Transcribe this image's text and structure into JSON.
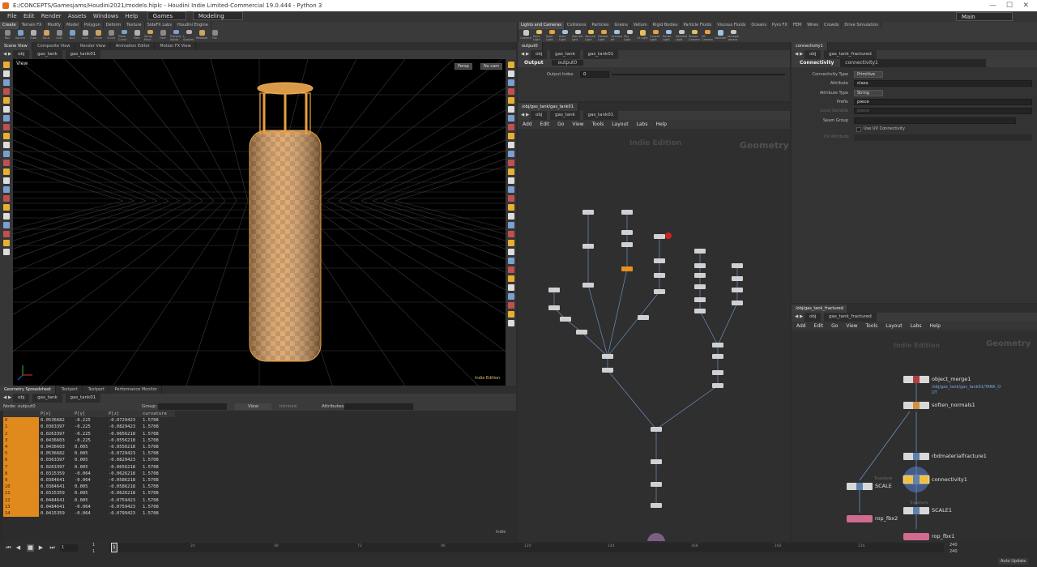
{
  "titlebar": {
    "path": "E:/CONCEPTS/Gamesjams/Houdini2021/models.hiplc - Houdini Indie Limited-Commercial 19.0.444 - Python 3",
    "workspace": "Main"
  },
  "menubar": {
    "items": [
      "File",
      "Edit",
      "Render",
      "Assets",
      "Windows",
      "Help"
    ],
    "desktops": [
      "Games",
      "Modeling"
    ]
  },
  "shelf_tabs_left": [
    "Create",
    "Terrain FX",
    "Modify",
    "Model",
    "Polygon",
    "Deform",
    "Texture",
    "SideFX Labs",
    "Houdini Engine"
  ],
  "shelf_tools_left": [
    "Box",
    "Sphere",
    "Tube",
    "Torus",
    "Grid",
    "Null",
    "Line",
    "Circle",
    "Curve",
    "Draw Curve",
    "Path",
    "Spray Paint",
    "Font",
    "Platonic Solids",
    "L-System",
    "Metaball",
    "File"
  ],
  "shelf_tabs_right": [
    "Lights and Cameras",
    "Collisions",
    "Particles",
    "Grains",
    "Vellum",
    "Rigid Bodies",
    "Particle Fluids",
    "Viscous Fluids",
    "Oceans",
    "Pyro FX",
    "FEM",
    "Wires",
    "Crowds",
    "Drive Simulation"
  ],
  "shelf_tools_right": [
    "Camera",
    "Point Light",
    "Spot Light",
    "Area Light",
    "Geometry Light",
    "Volume Light",
    "Distant Light",
    "Environment Light",
    "Sky Light",
    "GI Light",
    "Caustic Light",
    "Portal Light",
    "Ambient Light",
    "Stereo Camera",
    "VR Camera",
    "Switcher",
    "Gamepad Camera"
  ],
  "viewport": {
    "tabs": [
      "Scene View",
      "Composite View",
      "Render View",
      "Animation Editor",
      "Motion FX View"
    ],
    "path": [
      "obj",
      "gas_tank",
      "gas_tank01"
    ],
    "label": "View",
    "persp": "Persp",
    "cam": "No cam",
    "edition": "Indie Edition"
  },
  "spreadsheet": {
    "tabs": [
      "Geometry Spreadsheet",
      "Textport",
      "Textport",
      "Performance Monitor"
    ],
    "path": [
      "obj",
      "gas_tank",
      "gas_tank01"
    ],
    "node": "Node: output0",
    "group_label": "Group:",
    "view_label": "View",
    "intrinsic_label": "Intrinsic",
    "attributes_label": "Attributes:",
    "columns": [
      "",
      "P[x]",
      "P[y]",
      "P[z]",
      "curvature"
    ],
    "rows": [
      [
        "0",
        "0.0536682",
        "-0.225",
        "-0.0729423",
        "1.5708"
      ],
      [
        "1",
        "0.0363397",
        "-0.225",
        "-0.0829423",
        "1.5708"
      ],
      [
        "2",
        "0.0263397",
        "-0.225",
        "-0.0656218",
        "1.5708"
      ],
      [
        "3",
        "0.0436603",
        "-0.225",
        "-0.0556218",
        "1.5708"
      ],
      [
        "4",
        "0.0436603",
        "0.005",
        "-0.0556218",
        "1.5708"
      ],
      [
        "5",
        "0.0536682",
        "0.005",
        "-0.0729423",
        "1.5708"
      ],
      [
        "6",
        "0.0363397",
        "0.005",
        "-0.0829423",
        "1.5708"
      ],
      [
        "7",
        "0.0263397",
        "0.005",
        "-0.0656218",
        "1.5708"
      ],
      [
        "8",
        "0.0315359",
        "-0.064",
        "-0.0626218",
        "1.5708"
      ],
      [
        "9",
        "0.0384641",
        "-0.064",
        "-0.0586218",
        "1.5708"
      ],
      [
        "10",
        "0.0384641",
        "0.005",
        "-0.0586218",
        "1.5708"
      ],
      [
        "11",
        "0.0315359",
        "0.005",
        "-0.0626218",
        "1.5708"
      ],
      [
        "12",
        "0.0484641",
        "0.005",
        "-0.0759423",
        "1.5708"
      ],
      [
        "13",
        "0.0484641",
        "-0.064",
        "-0.0759423",
        "1.5708"
      ],
      [
        "14",
        "0.0415359",
        "-0.064",
        "-0.0799423",
        "1.5708"
      ]
    ],
    "footer": "Indie"
  },
  "output_pane": {
    "tab": "output0",
    "path": [
      "obj",
      "gas_tank",
      "gas_tank01"
    ],
    "node_type": "Output",
    "node_name": "output0",
    "param_label": "Output Index",
    "param_value": "0"
  },
  "network_center": {
    "tab": "/obj/gas_tank/gas_tank01",
    "path": [
      "obj",
      "gas_tank",
      "gas_tank01"
    ],
    "menu": [
      "Add",
      "Edit",
      "Go",
      "View",
      "Tools",
      "Layout",
      "Labs",
      "Help"
    ],
    "watermark": "Indie Edition",
    "context": "Geometry"
  },
  "param_right": {
    "tab": "connectivity1",
    "path": [
      "obj",
      "gas_tank_fractured"
    ],
    "node_type": "Connectivity",
    "node_name": "connectivity1",
    "rows": [
      {
        "label": "Connectivity Type",
        "value": "Primitive"
      },
      {
        "label": "Attribute",
        "value": "class"
      },
      {
        "label": "Attribute Type",
        "value": "String"
      },
      {
        "label": "Prefix",
        "value": "piece"
      },
      {
        "label": "Local Variable",
        "value": "piece"
      },
      {
        "label": "Seam Group",
        "value": ""
      }
    ],
    "uv_toggle": "Use UV Connectivity",
    "uv_attr_label": "UV Attribute"
  },
  "network_right": {
    "tab": "/obj/gas_tank_fractured",
    "path": [
      "obj",
      "gas_tank_fractured"
    ],
    "menu": [
      "Add",
      "Edit",
      "Go",
      "View",
      "Tools",
      "Layout",
      "Labs",
      "Help"
    ],
    "watermark": "Indie Edition",
    "context": "Geometry",
    "nodes": {
      "object_merge": "object_merge1",
      "object_merge_sub": "/obj/gas_tank/gas_tank01/TANK_O",
      "object_merge_sub2": "UT",
      "soften": "soften_normals1",
      "rbd": "rbdmaterialfracture1",
      "connectivity": "connectivity1",
      "scale": "SCALE",
      "scale1": "SCALE1",
      "transform_tag": "Transform",
      "rop2": "rop_fbx2",
      "rop1": "rop_fbx1"
    }
  },
  "timeline": {
    "frame": "1",
    "start": "1",
    "start2": "1",
    "end": "240",
    "end2": "240",
    "ticks": [
      "24",
      "48",
      "72",
      "96",
      "120",
      "144",
      "168",
      "192",
      "216"
    ],
    "auto_update": "Auto Update"
  },
  "accent": "#e08a1e"
}
